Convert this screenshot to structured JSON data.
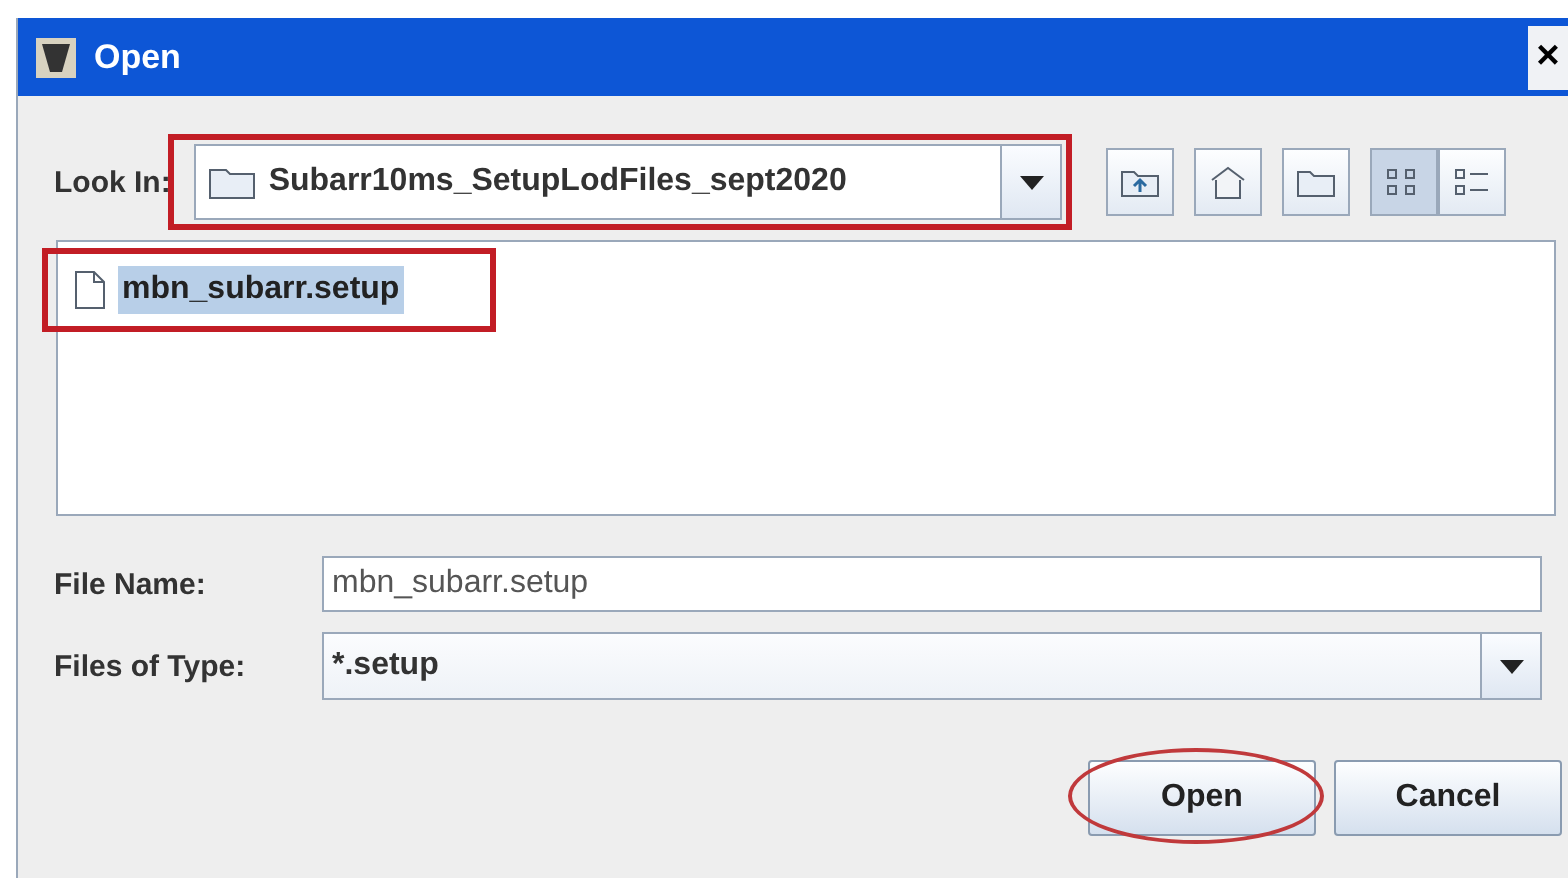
{
  "window": {
    "title": "Open",
    "close": "×"
  },
  "look_in": {
    "label": "Look In:",
    "value": "Subarr10ms_SetupLodFiles_sept2020",
    "highlighted": true
  },
  "toolbar": [
    {
      "kind": "up",
      "selected": false
    },
    {
      "kind": "home",
      "selected": false
    },
    {
      "kind": "new_folder",
      "selected": false
    },
    {
      "kind": "list",
      "selected": true
    },
    {
      "kind": "details",
      "selected": false
    }
  ],
  "files": [
    {
      "name": "mbn_subarr.setup",
      "selected": true,
      "highlighted": true
    }
  ],
  "file_name": {
    "label": "File Name:",
    "value": "mbn_subarr.setup"
  },
  "file_type": {
    "label": "Files of Type:",
    "value": "*.setup"
  },
  "buttons": [
    {
      "label": "Open",
      "highlighted": true
    },
    {
      "label": "Cancel",
      "highlighted": false
    }
  ]
}
